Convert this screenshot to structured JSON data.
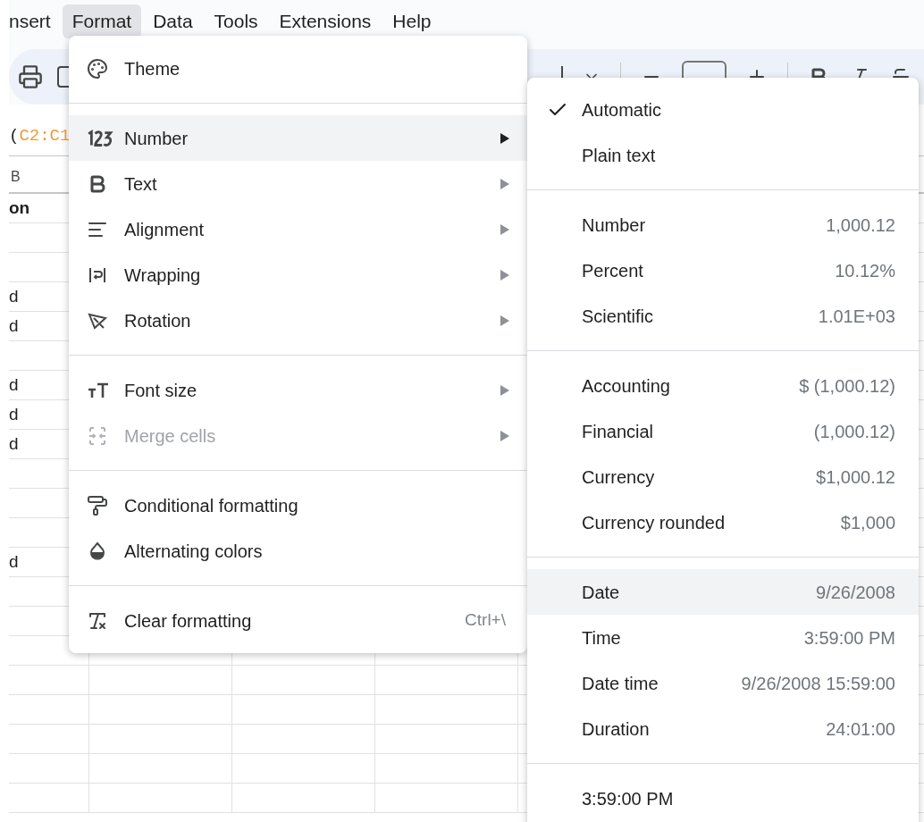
{
  "menubar": [
    {
      "label": "nsert",
      "selected": false
    },
    {
      "label": "Format",
      "selected": true
    },
    {
      "label": "Data",
      "selected": false
    },
    {
      "label": "Tools",
      "selected": false
    },
    {
      "label": "Extensions",
      "selected": false
    },
    {
      "label": "Help",
      "selected": false
    }
  ],
  "formula": {
    "prefix": "(",
    "range": "C2:C1"
  },
  "column_header": "B",
  "column_title": "on",
  "cells": [
    "",
    "",
    "d",
    "d",
    "",
    "d",
    "d",
    "d",
    "",
    "",
    "",
    "d"
  ],
  "format_menu": [
    {
      "kind": "item",
      "label": "Theme",
      "submenu": false,
      "disabled": false,
      "selected": false
    },
    {
      "kind": "separator"
    },
    {
      "kind": "item",
      "label": "Number",
      "submenu": true,
      "disabled": false,
      "selected": true
    },
    {
      "kind": "item",
      "label": "Text",
      "submenu": true,
      "disabled": false,
      "selected": false
    },
    {
      "kind": "item",
      "label": "Alignment",
      "submenu": true,
      "disabled": false,
      "selected": false
    },
    {
      "kind": "item",
      "label": "Wrapping",
      "submenu": true,
      "disabled": false,
      "selected": false
    },
    {
      "kind": "item",
      "label": "Rotation",
      "submenu": true,
      "disabled": false,
      "selected": false
    },
    {
      "kind": "separator"
    },
    {
      "kind": "item",
      "label": "Font size",
      "submenu": true,
      "disabled": false,
      "selected": false
    },
    {
      "kind": "item",
      "label": "Merge cells",
      "submenu": true,
      "disabled": true,
      "selected": false
    },
    {
      "kind": "separator"
    },
    {
      "kind": "item",
      "label": "Conditional formatting",
      "submenu": false,
      "disabled": false,
      "selected": false
    },
    {
      "kind": "item",
      "label": "Alternating colors",
      "submenu": false,
      "disabled": false,
      "selected": false
    },
    {
      "kind": "separator"
    },
    {
      "kind": "item",
      "label": "Clear formatting",
      "submenu": false,
      "disabled": false,
      "selected": false,
      "shortcut": "Ctrl+\\"
    }
  ],
  "number_menu": [
    {
      "kind": "item",
      "label": "Automatic",
      "checked": true,
      "selected": false
    },
    {
      "kind": "item",
      "label": "Plain text",
      "checked": false,
      "selected": false
    },
    {
      "kind": "separator"
    },
    {
      "kind": "item",
      "label": "Number",
      "value": "1,000.12",
      "checked": false,
      "selected": false
    },
    {
      "kind": "item",
      "label": "Percent",
      "value": "10.12%",
      "checked": false,
      "selected": false
    },
    {
      "kind": "item",
      "label": "Scientific",
      "value": "1.01E+03",
      "checked": false,
      "selected": false
    },
    {
      "kind": "separator"
    },
    {
      "kind": "item",
      "label": "Accounting",
      "value": "$ (1,000.12)",
      "checked": false,
      "selected": false
    },
    {
      "kind": "item",
      "label": "Financial",
      "value": "(1,000.12)",
      "checked": false,
      "selected": false
    },
    {
      "kind": "item",
      "label": "Currency",
      "value": "$1,000.12",
      "checked": false,
      "selected": false
    },
    {
      "kind": "item",
      "label": "Currency rounded",
      "value": "$1,000",
      "checked": false,
      "selected": false
    },
    {
      "kind": "separator"
    },
    {
      "kind": "item",
      "label": "Date",
      "value": "9/26/2008",
      "checked": false,
      "selected": true
    },
    {
      "kind": "item",
      "label": "Time",
      "value": "3:59:00 PM",
      "checked": false,
      "selected": false
    },
    {
      "kind": "item",
      "label": "Date time",
      "value": "9/26/2008 15:59:00",
      "checked": false,
      "selected": false
    },
    {
      "kind": "item",
      "label": "Duration",
      "value": "24:01:00",
      "checked": false,
      "selected": false
    },
    {
      "kind": "separator"
    },
    {
      "kind": "item",
      "label": "3:59:00 PM",
      "checked": false,
      "selected": false
    }
  ]
}
